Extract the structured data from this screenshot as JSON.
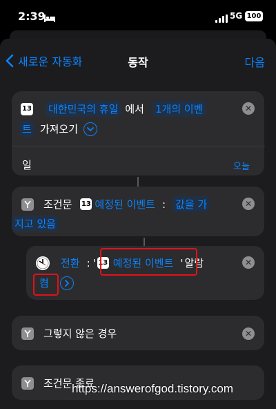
{
  "status_bar": {
    "time": "2:39",
    "network": "5G",
    "battery": "100"
  },
  "nav": {
    "back_label": "새로운 자동화",
    "title": "동작",
    "next_label": "다음"
  },
  "action1": {
    "calendar_day": "13",
    "holiday_token": "대한민국의 휴일",
    "word_from": "에서",
    "count_token_part1": "1개의 이벤",
    "count_token_part2": "트",
    "word_get": "가져오기",
    "field_label": "일",
    "field_value": "오늘"
  },
  "condition": {
    "label": "조건문",
    "event_token": "예정된 이벤트",
    "colon": ":",
    "value_part1": "값을 가",
    "value_part2": "지고 있음"
  },
  "nested": {
    "toggle_token": "전환",
    "colon": ":",
    "open_quote": "'",
    "event_token": "예정된 이벤트",
    "close_quote": "'",
    "alarm_word": "알람",
    "on_token": "켬"
  },
  "otherwise": {
    "label": "그렇지 않은 경우"
  },
  "end_if": {
    "label": "조건문 종료"
  },
  "watermark": "https://answerofgod.tistory.com",
  "colors": {
    "accent": "#0a84ff",
    "highlight_box": "#e0121b",
    "card_bg": "#2c2c2e"
  }
}
